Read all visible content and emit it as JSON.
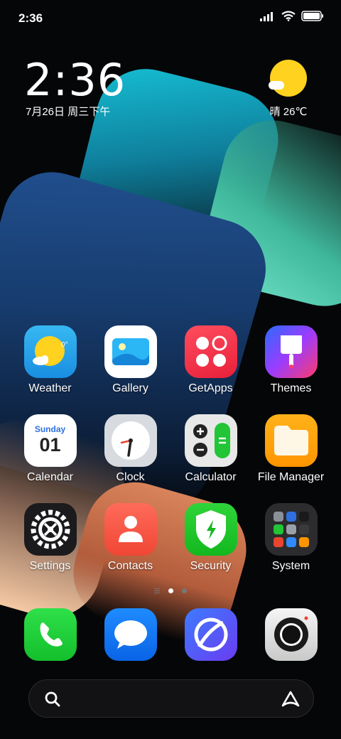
{
  "status_bar": {
    "time": "2:36"
  },
  "widget": {
    "time": "2:36",
    "date": "7月26日 周三下午",
    "weather": "晴 26℃"
  },
  "apps": [
    {
      "name": "Weather",
      "icon": "weather-icon",
      "temp_badge": "0°"
    },
    {
      "name": "Gallery",
      "icon": "gallery-icon"
    },
    {
      "name": "GetApps",
      "icon": "getapps-icon"
    },
    {
      "name": "Themes",
      "icon": "themes-icon"
    },
    {
      "name": "Calendar",
      "icon": "calendar-icon",
      "day": "Sunday",
      "date": "01"
    },
    {
      "name": "Clock",
      "icon": "clock-icon"
    },
    {
      "name": "Calculator",
      "icon": "calculator-icon"
    },
    {
      "name": "File Manager",
      "icon": "file-manager-icon"
    },
    {
      "name": "Settings",
      "icon": "settings-icon"
    },
    {
      "name": "Contacts",
      "icon": "contacts-icon"
    },
    {
      "name": "Security",
      "icon": "security-icon"
    },
    {
      "name": "System",
      "icon": "system-folder-icon"
    }
  ],
  "dock": [
    {
      "icon": "phone-icon"
    },
    {
      "icon": "messages-icon"
    },
    {
      "icon": "browser-icon"
    },
    {
      "icon": "camera-icon"
    }
  ],
  "pager": {
    "pages": 2,
    "current": 1
  },
  "colors": {
    "sun": "#ffd21f",
    "accent_green": "#13b81f"
  }
}
